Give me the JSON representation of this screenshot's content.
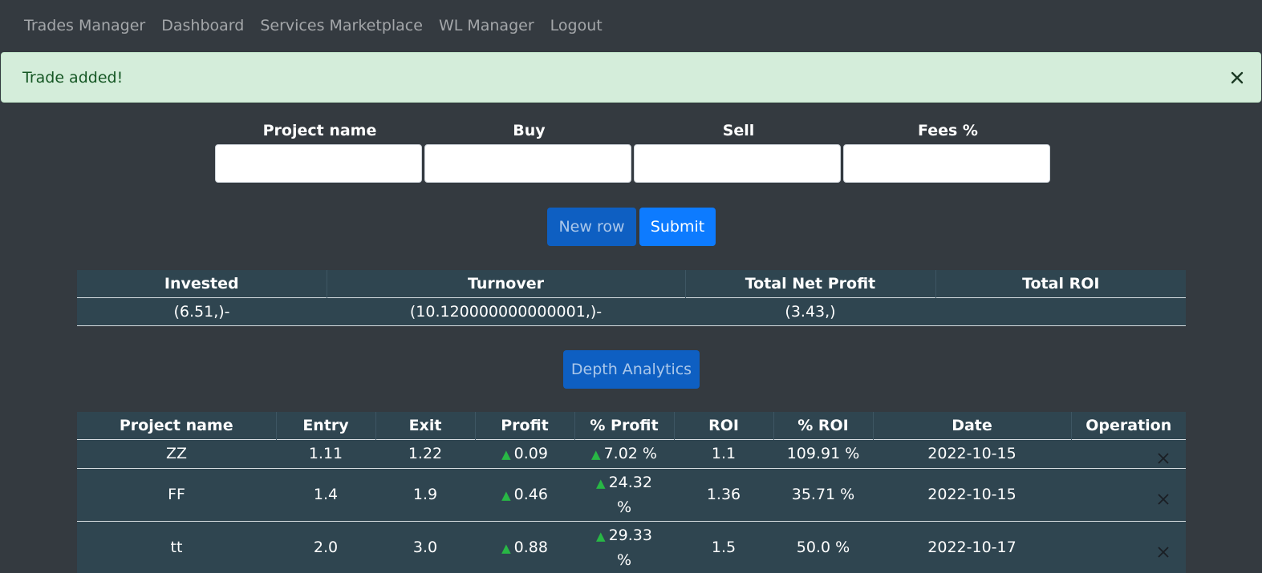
{
  "nav": {
    "items": [
      {
        "label": "Trades Manager"
      },
      {
        "label": "Dashboard"
      },
      {
        "label": "Services Marketplace"
      },
      {
        "label": "WL Manager"
      },
      {
        "label": "Logout"
      }
    ]
  },
  "alert": {
    "message": "Trade added!",
    "close_icon": "close-icon"
  },
  "form": {
    "labels": [
      "Project name",
      "Buy",
      "Sell",
      "Fees %"
    ],
    "values": [
      "",
      "",
      "",
      ""
    ]
  },
  "buttons": {
    "new_row": "New row",
    "submit": "Submit",
    "depth_analytics": "Depth Analytics"
  },
  "summary": {
    "headers": [
      "Invested",
      "Turnover",
      "Total Net Profit",
      "Total ROI"
    ],
    "values": [
      "(6.51,)-",
      "(10.120000000000001,)-",
      "(3.43,)",
      ""
    ]
  },
  "trades": {
    "headers": [
      "Project name",
      "Entry",
      "Exit",
      "Profit",
      "% Profit",
      "ROI",
      "% ROI",
      "Date",
      "Operation"
    ],
    "up_arrow": "▲",
    "rows": [
      {
        "project": "ZZ",
        "entry": "1.11",
        "exit": "1.22",
        "profit": "0.09",
        "pct_profit": "7.02 %",
        "roi": "1.1",
        "pct_roi": "109.91 %",
        "date": "2022-10-15"
      },
      {
        "project": "FF",
        "entry": "1.4",
        "exit": "1.9",
        "profit": "0.46",
        "pct_profit": "24.32 %",
        "roi": "1.36",
        "pct_roi": "35.71 %",
        "date": "2022-10-15"
      },
      {
        "project": "tt",
        "entry": "2.0",
        "exit": "3.0",
        "profit": "0.88",
        "pct_profit": "29.33 %",
        "roi": "1.5",
        "pct_roi": "50.0 %",
        "date": "2022-10-17"
      }
    ]
  },
  "colors": {
    "background": "#343a40",
    "alert_bg": "#d4edda",
    "table_bg": "#2f4550",
    "up_arrow": "#28b745",
    "primary": "#0d7bff"
  }
}
